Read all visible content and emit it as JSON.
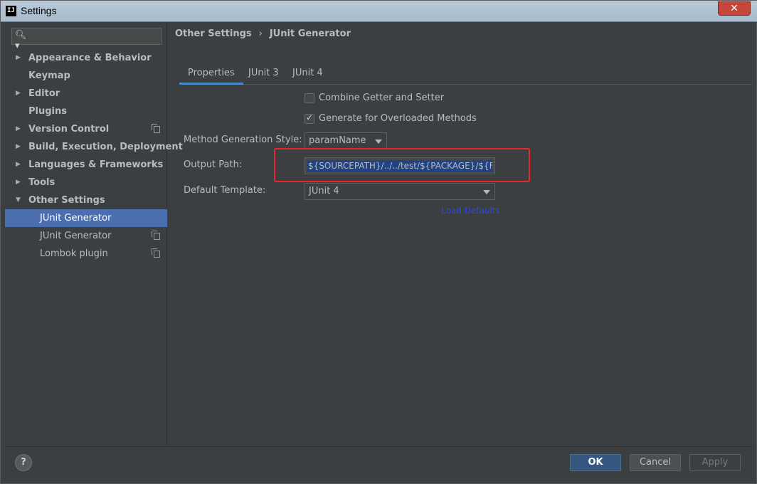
{
  "window": {
    "title": "Settings",
    "icon_text": "IJ",
    "close_glyph": "✕"
  },
  "search": {
    "icon_glyph": "🔍︎▾",
    "value": ""
  },
  "sidebar": {
    "items": [
      {
        "label": "Appearance & Behavior",
        "arrow": "▶",
        "copy": false,
        "child": false,
        "selected": false
      },
      {
        "label": "Keymap",
        "arrow": "",
        "copy": false,
        "child": false,
        "selected": false
      },
      {
        "label": "Editor",
        "arrow": "▶",
        "copy": false,
        "child": false,
        "selected": false
      },
      {
        "label": "Plugins",
        "arrow": "",
        "copy": false,
        "child": false,
        "selected": false
      },
      {
        "label": "Version Control",
        "arrow": "▶",
        "copy": true,
        "child": false,
        "selected": false
      },
      {
        "label": "Build, Execution, Deployment",
        "arrow": "▶",
        "copy": false,
        "child": false,
        "selected": false
      },
      {
        "label": "Languages & Frameworks",
        "arrow": "▶",
        "copy": false,
        "child": false,
        "selected": false
      },
      {
        "label": "Tools",
        "arrow": "▶",
        "copy": false,
        "child": false,
        "selected": false
      },
      {
        "label": "Other Settings",
        "arrow": "▼",
        "copy": false,
        "child": false,
        "selected": false
      },
      {
        "label": "JUnit Generator",
        "arrow": "",
        "copy": false,
        "child": true,
        "selected": true
      },
      {
        "label": "JUnit Generator",
        "arrow": "",
        "copy": true,
        "child": true,
        "selected": false
      },
      {
        "label": "Lombok plugin",
        "arrow": "",
        "copy": true,
        "child": true,
        "selected": false
      }
    ]
  },
  "breadcrumb": {
    "parent": "Other Settings",
    "separator": "›",
    "current": "JUnit Generator"
  },
  "tabs": [
    {
      "label": "Properties",
      "active": true
    },
    {
      "label": "JUnit 3",
      "active": false
    },
    {
      "label": "JUnit 4",
      "active": false
    }
  ],
  "form": {
    "combine_getter_setter": {
      "label": "Combine Getter and Setter",
      "checked": false
    },
    "generate_overloaded": {
      "label": "Generate for Overloaded Methods",
      "checked": true
    },
    "method_style": {
      "label": "Method Generation Style:",
      "value": "paramName"
    },
    "output_path": {
      "label": "Output Path:",
      "value": "${SOURCEPATH}/../../test/${PACKAGE}/${FILENAME}"
    },
    "default_template": {
      "label": "Default Template:",
      "value": "JUnit 4"
    },
    "load_defaults": "Load Defaults"
  },
  "footer": {
    "help": "?",
    "ok": "OK",
    "cancel": "Cancel",
    "apply": "Apply"
  },
  "colors": {
    "selection": "#4b6eaf",
    "primary_button": "#365880",
    "highlight_box": "#e8272b",
    "link": "#2a49e6"
  }
}
